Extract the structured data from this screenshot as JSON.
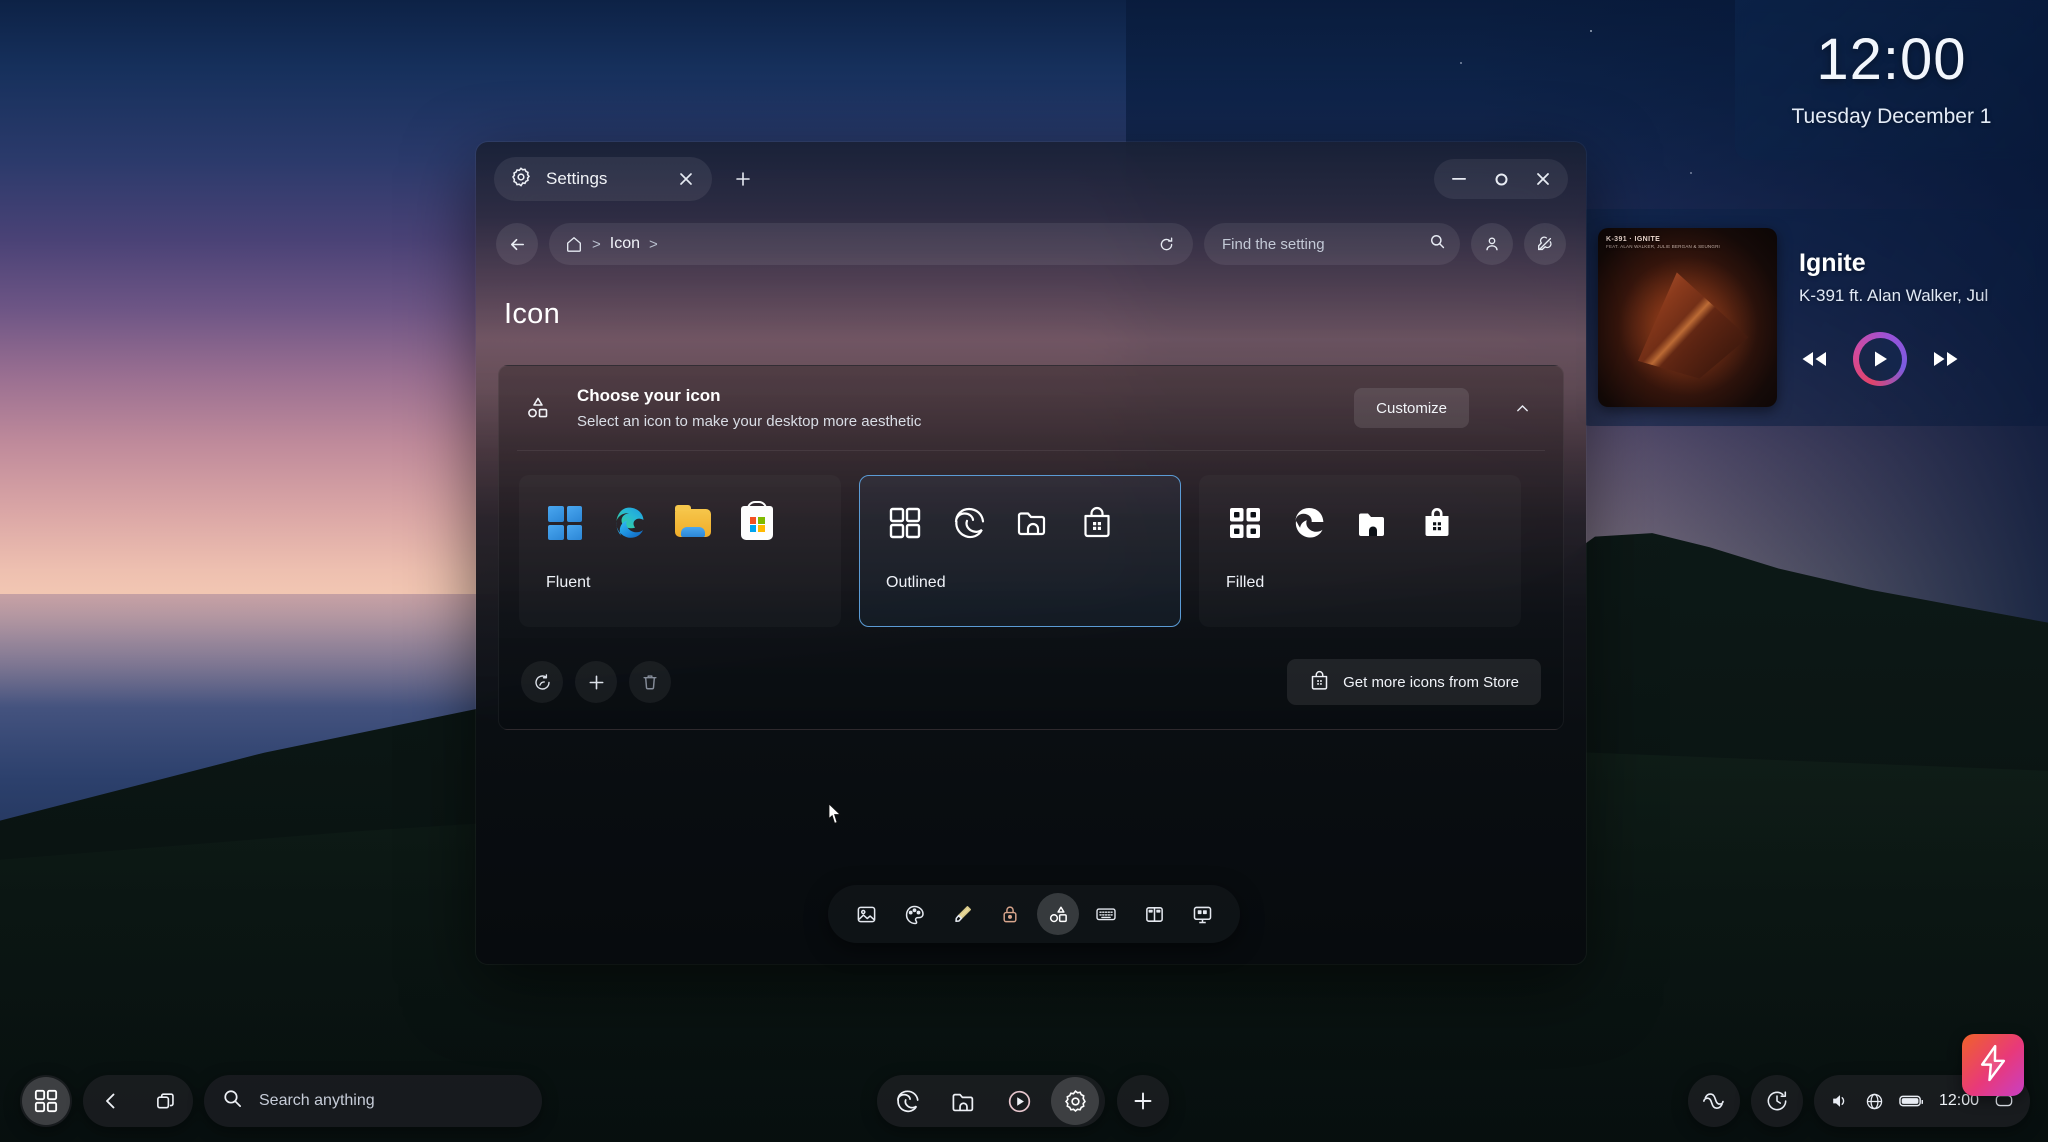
{
  "widgets": {
    "clock": {
      "time": "12:00",
      "date": "Tuesday December 1"
    },
    "music": {
      "title": "Ignite",
      "artist": "K-391 ft. Alan Walker, Jul",
      "album_art_label": "K-391 · IGNITE",
      "album_art_sub": "FEAT. ALAN WALKER, JULIE BERGAN & SEUNGRI",
      "prev_label": "Previous",
      "play_label": "Play",
      "next_label": "Next"
    }
  },
  "window": {
    "tab": {
      "label": "Settings",
      "close_label": "Close tab",
      "new_tab_label": "New tab"
    },
    "controls": {
      "minimize": "Minimize",
      "maximize": "Maximize",
      "close": "Close"
    },
    "nav": {
      "back_label": "Back",
      "home_label": "Home",
      "separator": ">",
      "breadcrumb": "Icon",
      "refresh_label": "Refresh",
      "account_label": "Account",
      "feedback_label": "Feedback"
    },
    "search": {
      "placeholder": "Find the setting",
      "value": ""
    },
    "page_title": "Icon",
    "card": {
      "heading": "Choose your icon",
      "subheading": "Select an icon to make your desktop more aesthetic",
      "customize_label": "Customize",
      "collapse_label": "Collapse",
      "header_icon": "shapes-icon",
      "options": [
        {
          "name": "Fluent",
          "selected": false,
          "style": "fluent"
        },
        {
          "name": "Outlined",
          "selected": true,
          "style": "outlined"
        },
        {
          "name": "Filled",
          "selected": false,
          "style": "filled"
        }
      ],
      "footer": {
        "reset_label": "Reset",
        "add_label": "Add",
        "delete_label": "Delete",
        "store_button": "Get more icons from Store"
      }
    },
    "accent_selected": "#5b9bd5"
  },
  "float_toolbar": {
    "items": [
      {
        "icon": "image-icon",
        "label": "Wallpaper",
        "active": false
      },
      {
        "icon": "palette-icon",
        "label": "Colors",
        "active": false
      },
      {
        "icon": "brush-icon",
        "label": "Themes",
        "active": false
      },
      {
        "icon": "lock-icon",
        "label": "Lock screen",
        "active": false
      },
      {
        "icon": "shapes-icon",
        "label": "Icon",
        "active": true
      },
      {
        "icon": "keyboard-icon",
        "label": "Keyboard",
        "active": false
      },
      {
        "icon": "taskbar-icon",
        "label": "Taskbar",
        "active": false
      },
      {
        "icon": "display-icon",
        "label": "Display",
        "active": false
      }
    ]
  },
  "taskbar": {
    "start_label": "Start",
    "back_label": "Back",
    "taskview_label": "Task view",
    "search": {
      "placeholder": "Search anything",
      "value": ""
    },
    "apps": [
      {
        "icon": "edge-icon",
        "label": "Microsoft Edge",
        "active": false
      },
      {
        "icon": "folder-icon",
        "label": "File Explorer",
        "active": false
      },
      {
        "icon": "media-icon",
        "label": "Media Player",
        "active": false
      },
      {
        "icon": "settings-icon",
        "label": "Settings",
        "active": true
      }
    ],
    "add_label": "Add",
    "tray": {
      "copilot_label": "Copilot",
      "history_label": "History",
      "volume_label": "Volume",
      "network_label": "Network",
      "battery_label": "Battery",
      "time": "12:00",
      "notification_label": "Notifications"
    },
    "battery_badge_label": "Power mode"
  }
}
